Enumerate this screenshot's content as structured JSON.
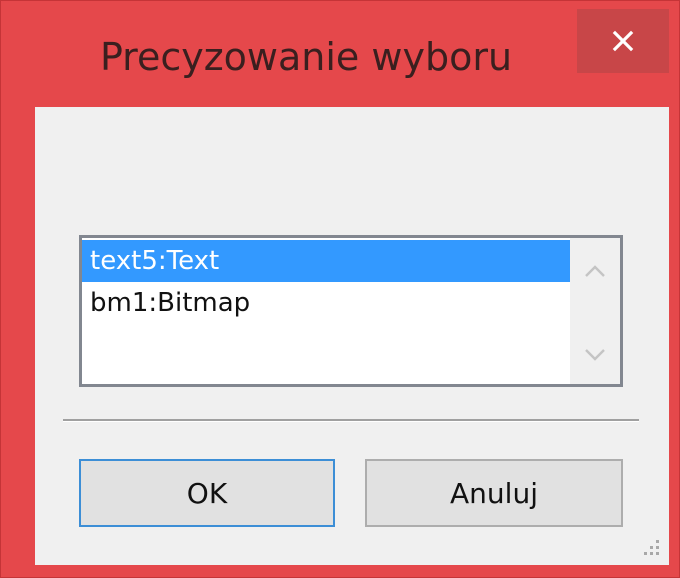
{
  "window": {
    "title": "Precyzowanie wyboru"
  },
  "listbox": {
    "items": [
      {
        "label": "text5:Text",
        "selected": true
      },
      {
        "label": "bm1:Bitmap",
        "selected": false
      }
    ]
  },
  "buttons": {
    "ok_label": "OK",
    "cancel_label": "Anuluj"
  },
  "icons": {
    "close": "close-icon",
    "scroll_up": "chevron-up-icon",
    "scroll_down": "chevron-down-icon",
    "grip": "resize-grip-icon"
  },
  "colors": {
    "frame": "#e5484b",
    "selection": "#3399ff",
    "ok_border": "#3c8ed6"
  }
}
